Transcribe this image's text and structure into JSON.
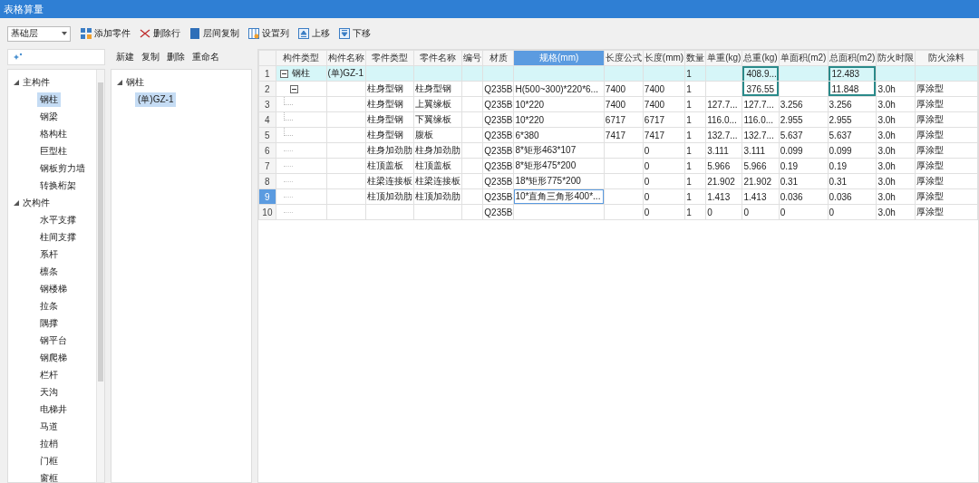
{
  "window": {
    "title": "表格算量"
  },
  "toolbar": {
    "floor_dropdown": "基础层",
    "buttons": [
      {
        "label": "添加零件",
        "kind": "add"
      },
      {
        "label": "删除行",
        "kind": "delete"
      },
      {
        "label": "层间复制",
        "kind": "copy"
      },
      {
        "label": "设置列",
        "kind": "columns"
      },
      {
        "label": "上移",
        "kind": "up"
      },
      {
        "label": "下移",
        "kind": "down"
      }
    ]
  },
  "category_tree": {
    "items": [
      {
        "label": "主构件",
        "expanded": true,
        "children": [
          {
            "label": "钢柱",
            "selected": true
          },
          {
            "label": "钢梁",
            "selected": false
          },
          {
            "label": "格构柱",
            "selected": false
          },
          {
            "label": "巨型柱",
            "selected": false
          },
          {
            "label": "钢板剪力墙",
            "selected": false
          },
          {
            "label": "转换桁架",
            "selected": false
          }
        ]
      },
      {
        "label": "次构件",
        "expanded": true,
        "children": [
          {
            "label": "水平支撑",
            "selected": false
          },
          {
            "label": "柱间支撑",
            "selected": false
          },
          {
            "label": "系杆",
            "selected": false
          },
          {
            "label": "檩条",
            "selected": false
          },
          {
            "label": "钢楼梯",
            "selected": false
          },
          {
            "label": "拉条",
            "selected": false
          },
          {
            "label": "隅撑",
            "selected": false
          },
          {
            "label": "钢平台",
            "selected": false
          },
          {
            "label": "钢爬梯",
            "selected": false
          },
          {
            "label": "栏杆",
            "selected": false
          },
          {
            "label": "天沟",
            "selected": false
          },
          {
            "label": "电梯井",
            "selected": false
          },
          {
            "label": "马道",
            "selected": false
          },
          {
            "label": "拉梢",
            "selected": false
          },
          {
            "label": "门框",
            "selected": false
          },
          {
            "label": "窗框",
            "selected": false
          }
        ]
      }
    ]
  },
  "component_panel": {
    "actions": [
      "新建",
      "复制",
      "删除",
      "重命名"
    ],
    "tree": [
      {
        "label": "钢柱",
        "expanded": true,
        "children": [
          {
            "label": "(单)GZ-1",
            "selected": true
          }
        ]
      }
    ]
  },
  "table": {
    "columns": [
      {
        "label": "构件类型",
        "selected": false
      },
      {
        "label": "构件名称",
        "selected": false
      },
      {
        "label": "零件类型",
        "selected": false
      },
      {
        "label": "零件名称",
        "selected": false
      },
      {
        "label": "编号",
        "selected": false
      },
      {
        "label": "材质",
        "selected": false
      },
      {
        "label": "规格(mm)",
        "selected": true
      },
      {
        "label": "长度公式",
        "selected": false
      },
      {
        "label": "长度(mm)",
        "selected": false
      },
      {
        "label": "数量",
        "selected": false
      },
      {
        "label": "单重(kg)",
        "selected": false
      },
      {
        "label": "总重(kg)",
        "selected": false
      },
      {
        "label": "单面积(m2)",
        "selected": false
      },
      {
        "label": "总面积(m2)",
        "selected": false
      },
      {
        "label": "防火时限",
        "selected": false
      },
      {
        "label": "防火涂料",
        "selected": false
      }
    ],
    "rows": [
      {
        "number": "1",
        "kind": "group",
        "selected": true,
        "current": false,
        "outlined": [
          false,
          false,
          false,
          false,
          false,
          false,
          false,
          false,
          false,
          false,
          false,
          true,
          false,
          true,
          false,
          false
        ],
        "cells": [
          "钢柱",
          "(单)GZ-1",
          "",
          "",
          "",
          "",
          "",
          "",
          "",
          "1",
          "",
          "408.9...",
          "",
          "12.483",
          "",
          ""
        ]
      },
      {
        "number": "2",
        "kind": "subgroup",
        "selected": false,
        "current": false,
        "outlined": [
          false,
          false,
          false,
          false,
          false,
          false,
          false,
          false,
          false,
          false,
          false,
          true,
          false,
          true,
          false,
          false
        ],
        "cells": [
          "",
          "",
          "柱身型钢",
          "柱身型钢",
          "",
          "Q235B",
          "H(500~300)*220*6...",
          "7400",
          "7400",
          "1",
          "",
          "376.55",
          "",
          "11.848",
          "3.0h",
          "厚涂型"
        ]
      },
      {
        "number": "3",
        "kind": "part",
        "selected": false,
        "current": false,
        "cells": [
          "",
          "",
          "柱身型钢",
          "上翼缘板",
          "",
          "Q235B",
          "10*220",
          "7400",
          "7400",
          "1",
          "127.7...",
          "127.7...",
          "3.256",
          "3.256",
          "3.0h",
          "厚涂型"
        ]
      },
      {
        "number": "4",
        "kind": "part",
        "selected": false,
        "current": false,
        "cells": [
          "",
          "",
          "柱身型钢",
          "下翼缘板",
          "",
          "Q235B",
          "10*220",
          "6717",
          "6717",
          "1",
          "116.0...",
          "116.0...",
          "2.955",
          "2.955",
          "3.0h",
          "厚涂型"
        ]
      },
      {
        "number": "5",
        "kind": "part",
        "selected": false,
        "current": false,
        "cells": [
          "",
          "",
          "柱身型钢",
          "腹板",
          "",
          "Q235B",
          "6*380",
          "7417",
          "7417",
          "1",
          "132.7...",
          "132.7...",
          "5.637",
          "5.637",
          "3.0h",
          "厚涂型"
        ]
      },
      {
        "number": "6",
        "kind": "item",
        "selected": false,
        "current": false,
        "cells": [
          "",
          "",
          "柱身加劲肋",
          "柱身加劲肋",
          "",
          "Q235B",
          "8*矩形463*107",
          "",
          "0",
          "1",
          "3.111",
          "3.111",
          "0.099",
          "0.099",
          "3.0h",
          "厚涂型"
        ]
      },
      {
        "number": "7",
        "kind": "item",
        "selected": false,
        "current": false,
        "cells": [
          "",
          "",
          "柱顶盖板",
          "柱顶盖板",
          "",
          "Q235B",
          "8*矩形475*200",
          "",
          "0",
          "1",
          "5.966",
          "5.966",
          "0.19",
          "0.19",
          "3.0h",
          "厚涂型"
        ]
      },
      {
        "number": "8",
        "kind": "item",
        "selected": false,
        "current": false,
        "cells": [
          "",
          "",
          "柱梁连接板",
          "柱梁连接板",
          "",
          "Q235B",
          "18*矩形775*200",
          "",
          "0",
          "1",
          "21.902",
          "21.902",
          "0.31",
          "0.31",
          "3.0h",
          "厚涂型"
        ]
      },
      {
        "number": "9",
        "kind": "item",
        "selected": false,
        "current": true,
        "focused": [
          false,
          false,
          false,
          false,
          false,
          false,
          true,
          false,
          false,
          false,
          false,
          false,
          false,
          false,
          false,
          false
        ],
        "cells": [
          "",
          "",
          "柱顶加劲肋",
          "柱顶加劲肋",
          "",
          "Q235B",
          "10*直角三角形400*...",
          "",
          "0",
          "1",
          "1.413",
          "1.413",
          "0.036",
          "0.036",
          "3.0h",
          "厚涂型"
        ]
      },
      {
        "number": "10",
        "kind": "item",
        "selected": false,
        "current": false,
        "cells": [
          "",
          "",
          "",
          "",
          "",
          "Q235B",
          "",
          "",
          "0",
          "1",
          "0",
          "0",
          "0",
          "0",
          "3.0h",
          "厚涂型"
        ]
      }
    ]
  }
}
